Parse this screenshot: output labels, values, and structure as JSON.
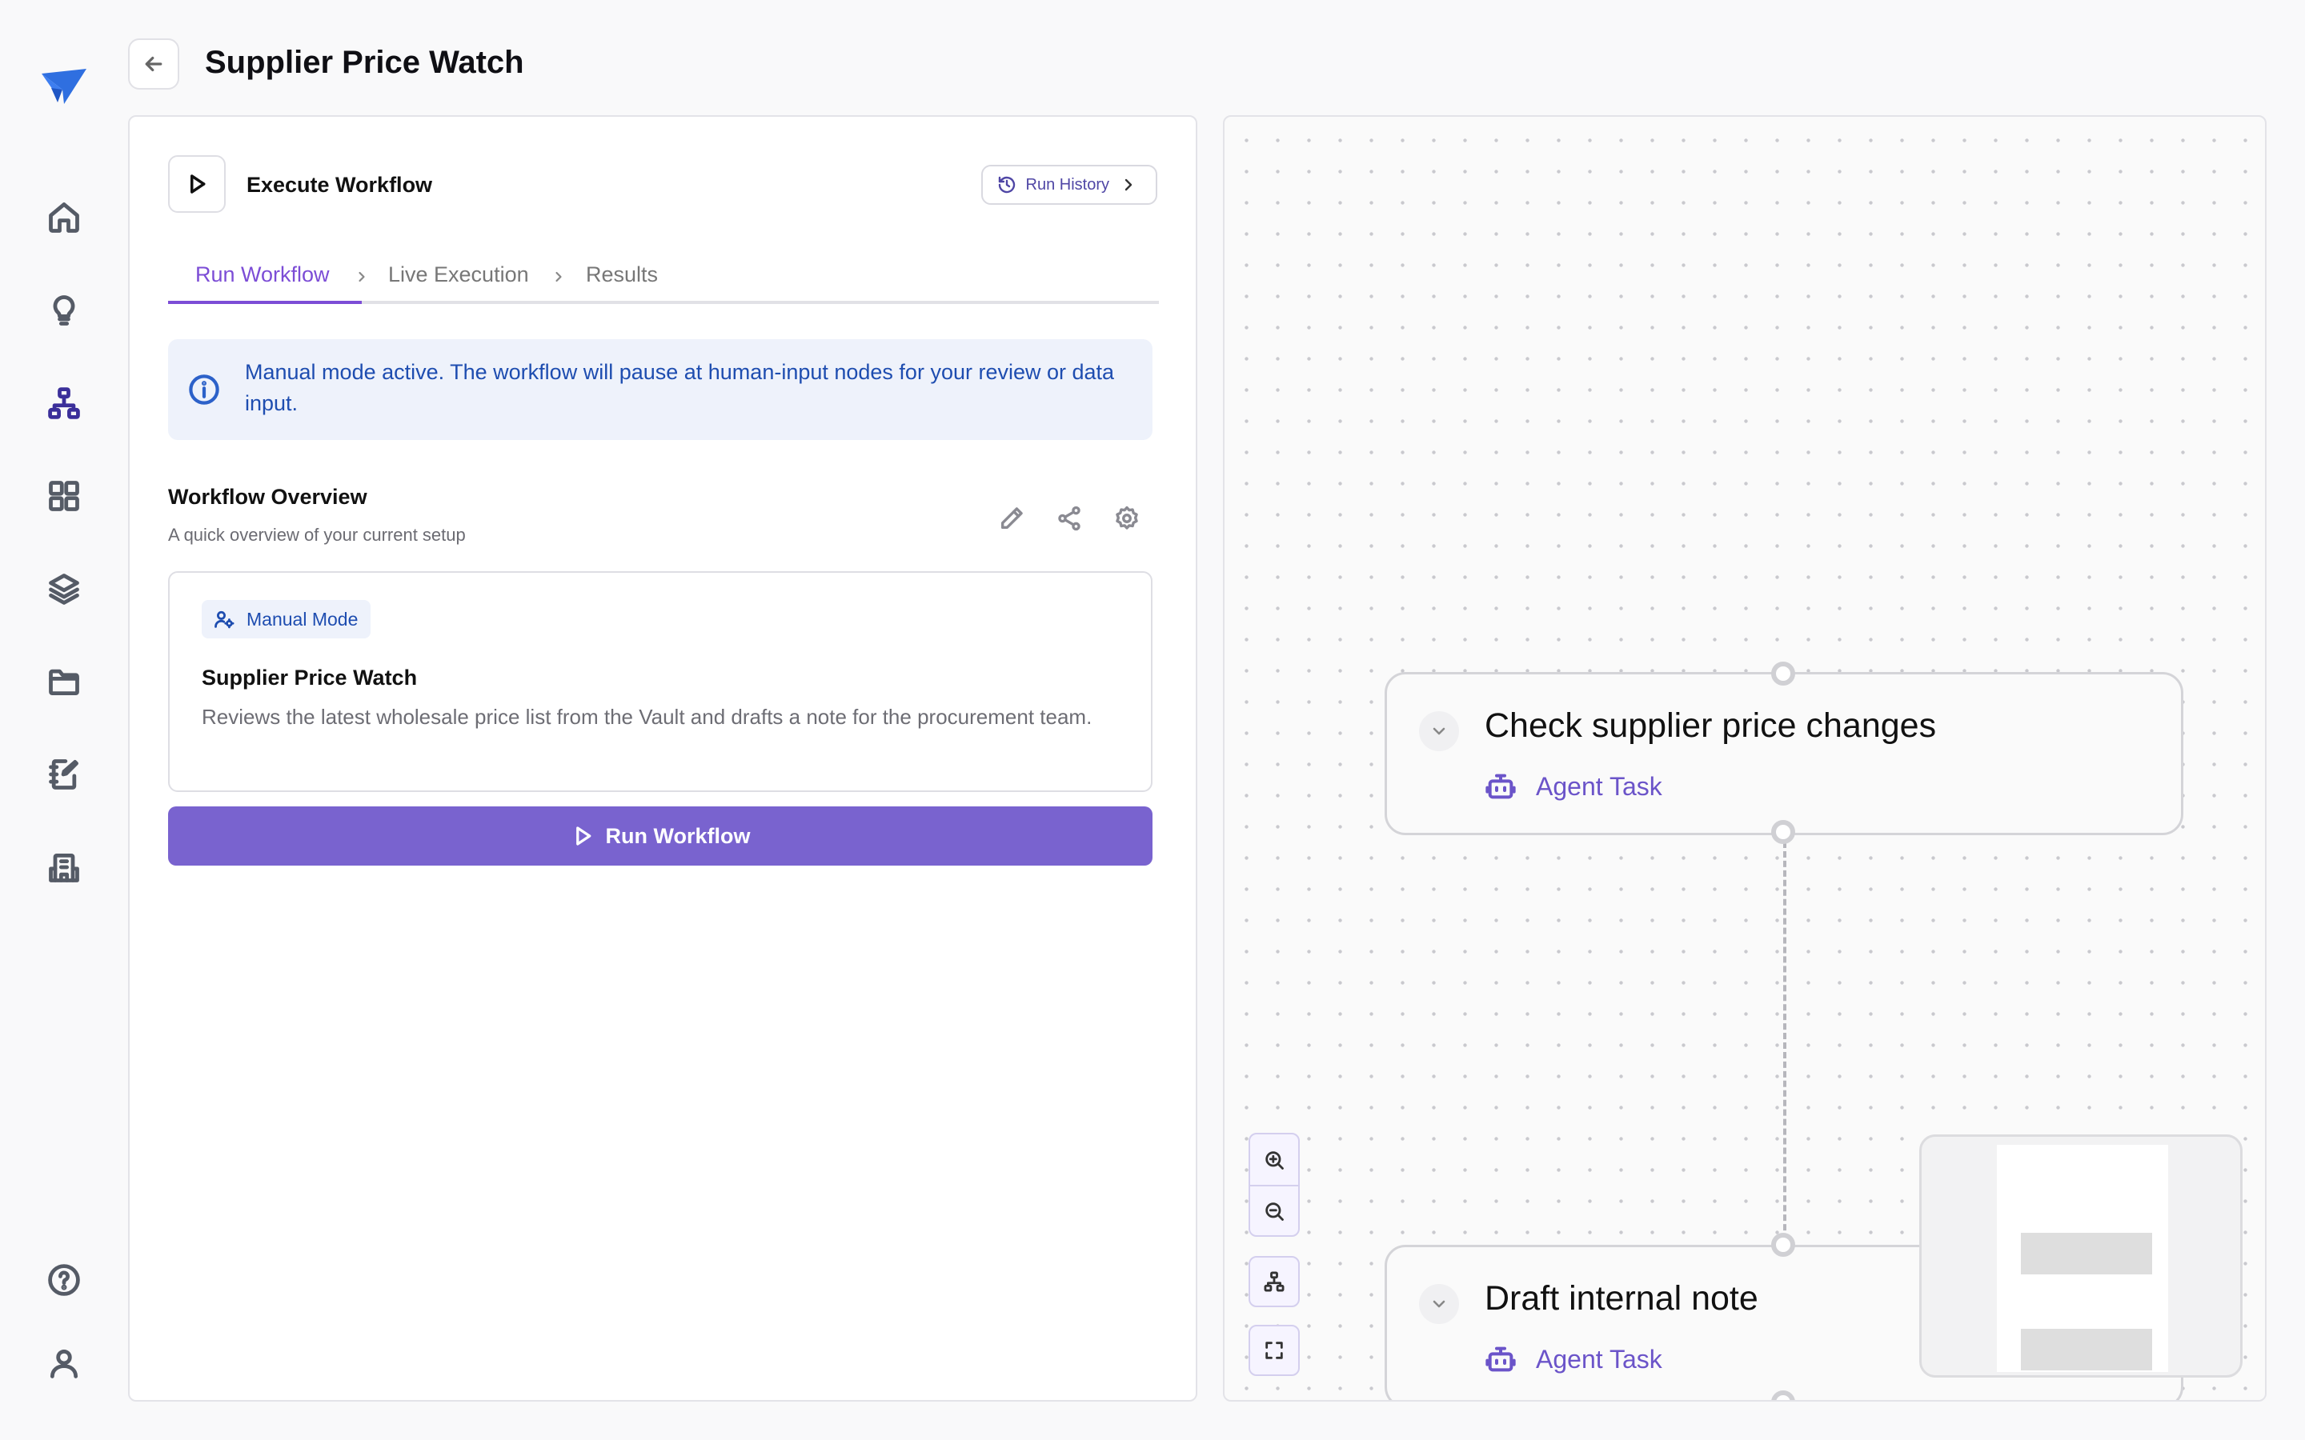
{
  "header": {
    "title": "Supplier Price Watch"
  },
  "panel": {
    "section_title": "Execute Workflow",
    "run_history_label": "Run History",
    "tabs": [
      {
        "label": "Run Workflow",
        "active": true
      },
      {
        "label": "Live Execution",
        "active": false
      },
      {
        "label": "Results",
        "active": false
      }
    ],
    "info_message": "Manual mode active. The workflow will pause at human-input nodes for your review or data input.",
    "overview": {
      "title": "Workflow Overview",
      "subtitle": "A quick overview of your current setup"
    },
    "workflow_card": {
      "mode_badge": "Manual Mode",
      "name": "Supplier Price Watch",
      "description": "Reviews the latest wholesale price list from the Vault and drafts a note for the procurement team."
    },
    "run_button_label": "Run Workflow"
  },
  "canvas": {
    "nodes": [
      {
        "title": "Check supplier price changes",
        "type": "Agent Task"
      },
      {
        "title": "Draft internal note",
        "type": "Agent Task"
      }
    ]
  },
  "colors": {
    "accent": "#7c4dd6",
    "primary_button": "#7963cf",
    "info_bg": "#eef2fb",
    "info_text": "#1e4db0"
  },
  "icons": {
    "rail": [
      "logo-icon",
      "home-icon",
      "lightbulb-icon",
      "workflow-icon",
      "grid-icon",
      "layers-icon",
      "folder-icon",
      "notebook-icon",
      "building-icon",
      "help-icon",
      "user-icon"
    ]
  }
}
